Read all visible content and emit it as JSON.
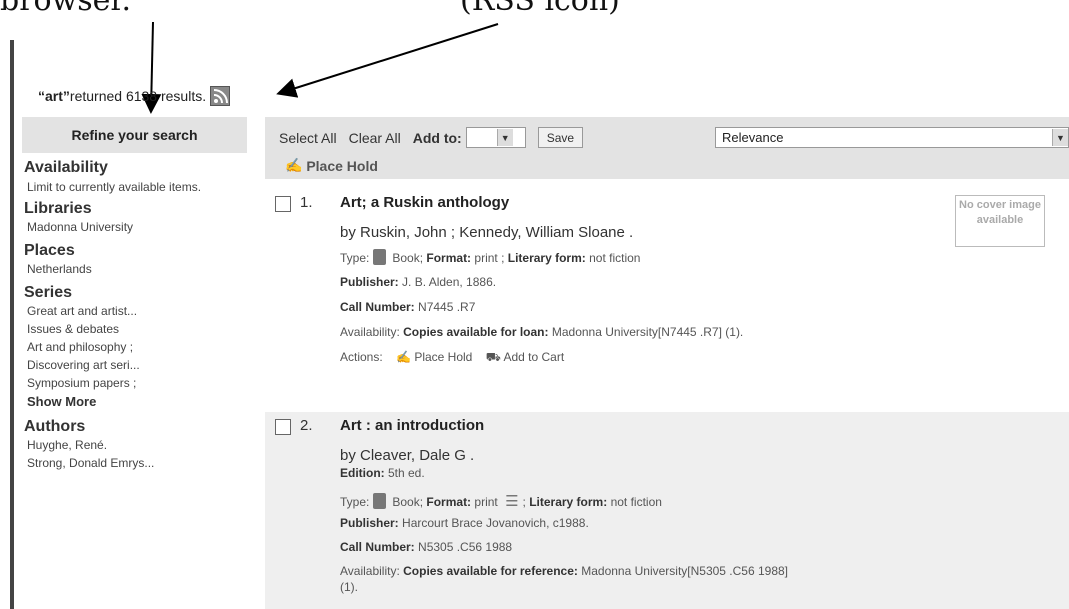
{
  "annotations": {
    "left_text": "browser.",
    "right_text": "(RSS icon)"
  },
  "summary": {
    "query": "“art”",
    "rest": " returned 6138 results."
  },
  "sidebar": {
    "header": "Refine your search",
    "facets": [
      {
        "title": "Availability",
        "items": [
          "Limit to currently available items."
        ]
      },
      {
        "title": "Libraries",
        "items": [
          "Madonna University"
        ]
      },
      {
        "title": "Places",
        "items": [
          "Netherlands"
        ]
      },
      {
        "title": "Series",
        "items": [
          "Great art and artist...",
          "Issues & debates",
          "Art and philosophy ;",
          "Discovering art seri...",
          "Symposium papers ;"
        ],
        "show_more": "Show More"
      },
      {
        "title": "Authors",
        "items": [
          "Huyghe, René.",
          "Strong, Donald Emrys..."
        ]
      }
    ]
  },
  "toolbar": {
    "select_all": "Select All",
    "clear_all": "Clear All",
    "add_to": "Add to:",
    "save": "Save",
    "sort_value": "Relevance",
    "place_hold": "Place Hold"
  },
  "results": [
    {
      "number": "1.",
      "title": "Art; a Ruskin anthology",
      "by": "by Ruskin, John ; Kennedy, William Sloane .",
      "type_label": "Type:",
      "type_value": "Book; ",
      "format_label": "Format:",
      "format_value": " print ; ",
      "lit_label": "Literary form:",
      "lit_value": " not fiction",
      "publisher_label": "Publisher:",
      "publisher_value": " J. B. Alden, 1886.",
      "call_label": "Call Number:",
      "call_value": " N7445 .R7",
      "avail_label": "Availability: ",
      "avail_strong": "Copies available for loan:",
      "avail_value": " Madonna University[N7445 .R7] (1).",
      "actions_label": "Actions:",
      "action_hold": "Place Hold",
      "action_cart": "Add to Cart",
      "cover": "No cover image available"
    },
    {
      "number": "2.",
      "title": "Art : an introduction",
      "by": "by Cleaver, Dale G .",
      "edition_label": "Edition:",
      "edition_value": " 5th ed.",
      "type_label": "Type:",
      "type_value": "Book; ",
      "format_label": "Format:",
      "format_value": " print ",
      "lit_label": "Literary form:",
      "lit_value": " not fiction",
      "publisher_label": "Publisher:",
      "publisher_value": " Harcourt Brace Jovanovich, c1988.",
      "call_label": "Call Number:",
      "call_value": " N5305 .C56 1988",
      "avail_label": "Availability: ",
      "avail_strong": "Copies available for reference:",
      "avail_value": " Madonna University[N5305 .C56 1988]",
      "avail_value2": "(1)."
    }
  ]
}
